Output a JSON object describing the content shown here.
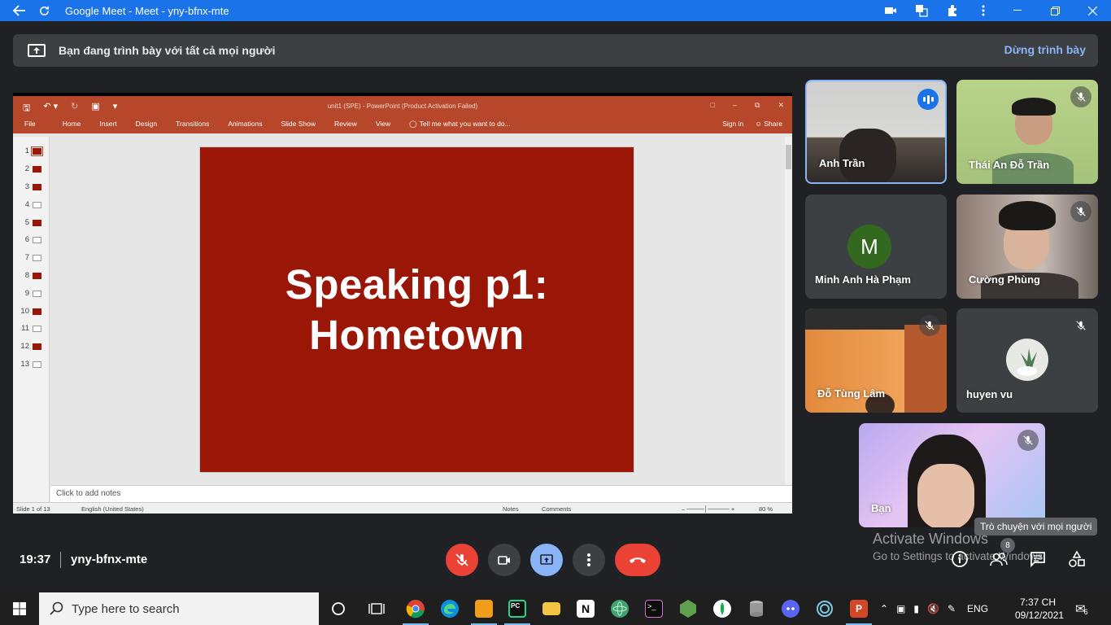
{
  "browser": {
    "title": "Google Meet - Meet - yny-bfnx-mte"
  },
  "banner": {
    "text": "Bạn đang trình bày với tất cả mọi người",
    "stop_label": "Dừng trình bày"
  },
  "ppt": {
    "window_title": "unit1 (SPE) - PowerPoint (Product Activation Failed)",
    "tabs": [
      "File",
      "Home",
      "Insert",
      "Design",
      "Transitions",
      "Animations",
      "Slide Show",
      "Review",
      "View"
    ],
    "tell_me": "Tell me what you want to do...",
    "sign_in": "Sign in",
    "share": "Share",
    "slide_numbers": [
      "1",
      "2",
      "3",
      "4",
      "5",
      "6",
      "7",
      "8",
      "9",
      "10",
      "11",
      "12",
      "13"
    ],
    "slide_title_line1": "Speaking p1:",
    "slide_title_line2": "Hometown",
    "notes_placeholder": "Click to add notes",
    "status": {
      "slide": "Slide 1 of 13",
      "language": "English (United States)",
      "notes": "Notes",
      "comments": "Comments",
      "zoom": "80 %"
    }
  },
  "participants": [
    {
      "name": "Anh Trần",
      "speaking": true
    },
    {
      "name": "Thái An Đỗ Trần",
      "muted": true
    },
    {
      "name": "Minh Anh Hà Phạm",
      "initial": "M"
    },
    {
      "name": "Cường Phùng",
      "muted": true
    },
    {
      "name": "Đỗ Tùng Lâm",
      "muted": true
    },
    {
      "name": "huyen vu",
      "muted": true
    },
    {
      "name": "Bạn",
      "muted": true
    }
  ],
  "meeting": {
    "time": "19:37",
    "code": "yny-bfnx-mte",
    "people_count": "8"
  },
  "tooltip": "Trò chuyện với mọi người",
  "activate": {
    "line1": "Activate Windows",
    "line2": "Go to Settings to activate Windows."
  },
  "taskbar": {
    "search_placeholder": "Type here to search",
    "language": "ENG",
    "time": "7:37 CH",
    "date": "09/12/2021",
    "notifications": "6"
  },
  "colors": {
    "accent": "#1a73e8",
    "end_call": "#ea4335",
    "slide_bg": "#9a1607",
    "ppt_ribbon": "#b7472a"
  }
}
